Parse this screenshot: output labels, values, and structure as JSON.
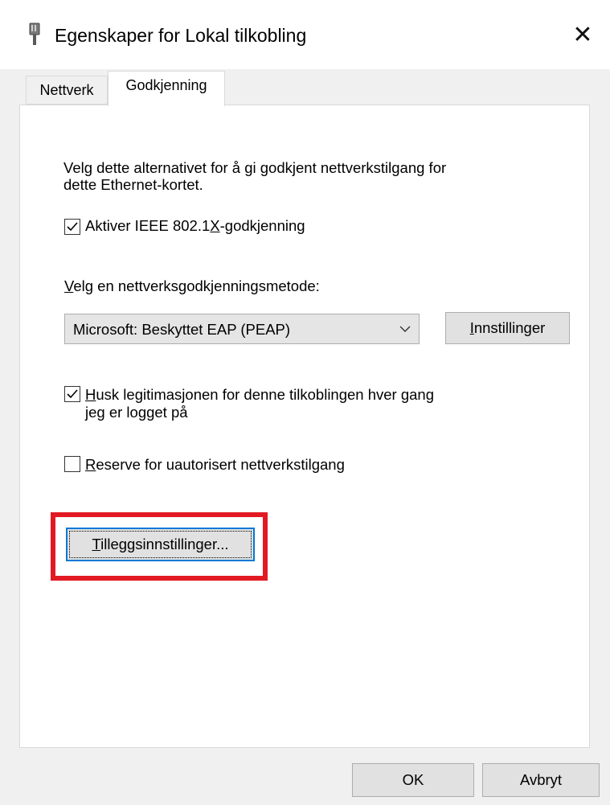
{
  "window": {
    "title": "Egenskaper for Lokal tilkobling",
    "icon": "network-adapter-icon",
    "close_label": "✕"
  },
  "tabs": [
    {
      "label": "Nettverk",
      "active": false
    },
    {
      "label": "Godkjenning",
      "active": true
    }
  ],
  "panel": {
    "description_line1": "Velg dette alternativet for å gi godkjent nettverkstilgang for",
    "description_line2": "dette Ethernet-kortet.",
    "enable_8021x": {
      "pre": "Aktiver IEEE 802.1",
      "accel": "X",
      "post": "-godkjenning",
      "checked": true
    },
    "method_label": {
      "accel": "V",
      "rest": "elg en nettverksgodkjenningsmetode:"
    },
    "method_select": {
      "value": "Microsoft: Beskyttet EAP (PEAP)"
    },
    "settings_button": {
      "accel": "I",
      "rest": "nnstillinger"
    },
    "remember_credentials": {
      "accel": "H",
      "line1_rest": "usk legitimasjonen for denne tilkoblingen hver gang",
      "line2": "jeg er logget på",
      "checked": true
    },
    "fallback": {
      "accel": "R",
      "rest": "eserve for uautorisert nettverkstilgang",
      "checked": false
    },
    "additional_settings_button": {
      "accel": "T",
      "rest": "illeggsinnstillinger..."
    }
  },
  "footer": {
    "ok_label": "OK",
    "cancel_label": "Avbryt"
  },
  "colors": {
    "highlight": "#e11a23",
    "focus": "#0078d7"
  }
}
